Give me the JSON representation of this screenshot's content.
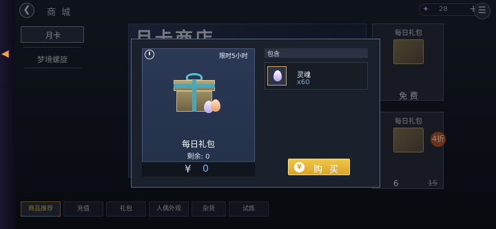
{
  "topbar": {
    "back_icon": "back-arrow-icon",
    "title": "商 城",
    "currency": {
      "icon": "soul-crystal-icon",
      "amount": "28",
      "add_icon": "plus-icon"
    },
    "menu_icon": "hamburger-menu-icon"
  },
  "sidebar": {
    "tabs": [
      {
        "label": "月卡",
        "active": true
      },
      {
        "label": "梦境螺旋",
        "active": false
      }
    ]
  },
  "banner": {
    "title": "月卡商店"
  },
  "cards": [
    {
      "title": "每日礼包",
      "price_label": "免 费"
    },
    {
      "title": "每日礼包",
      "discount": "4折",
      "price": "6",
      "original_price": "15"
    }
  ],
  "modal": {
    "time_limit": "限时5小时",
    "item_name": "每日礼包",
    "remaining": "剩余: 0",
    "currency_symbol": "¥",
    "price": "0",
    "contents_label": "包含",
    "contents": [
      {
        "name": "灵魂",
        "quantity": "x60",
        "icon": "soul-egg-icon"
      }
    ],
    "buy_button": {
      "icon": "yen-coin-icon",
      "icon_glyph": "¥",
      "label": "购 买"
    }
  },
  "bottom_tabs": [
    {
      "label": "商品推荐",
      "active": true
    },
    {
      "label": "充值",
      "active": false
    },
    {
      "label": "礼包",
      "active": false
    },
    {
      "label": "人偶外观",
      "active": false
    },
    {
      "label": "杂货",
      "active": false
    },
    {
      "label": "试炼",
      "active": false
    }
  ],
  "colors": {
    "accent_gold": "#e8c869",
    "price_blue": "#7fb0ff"
  }
}
